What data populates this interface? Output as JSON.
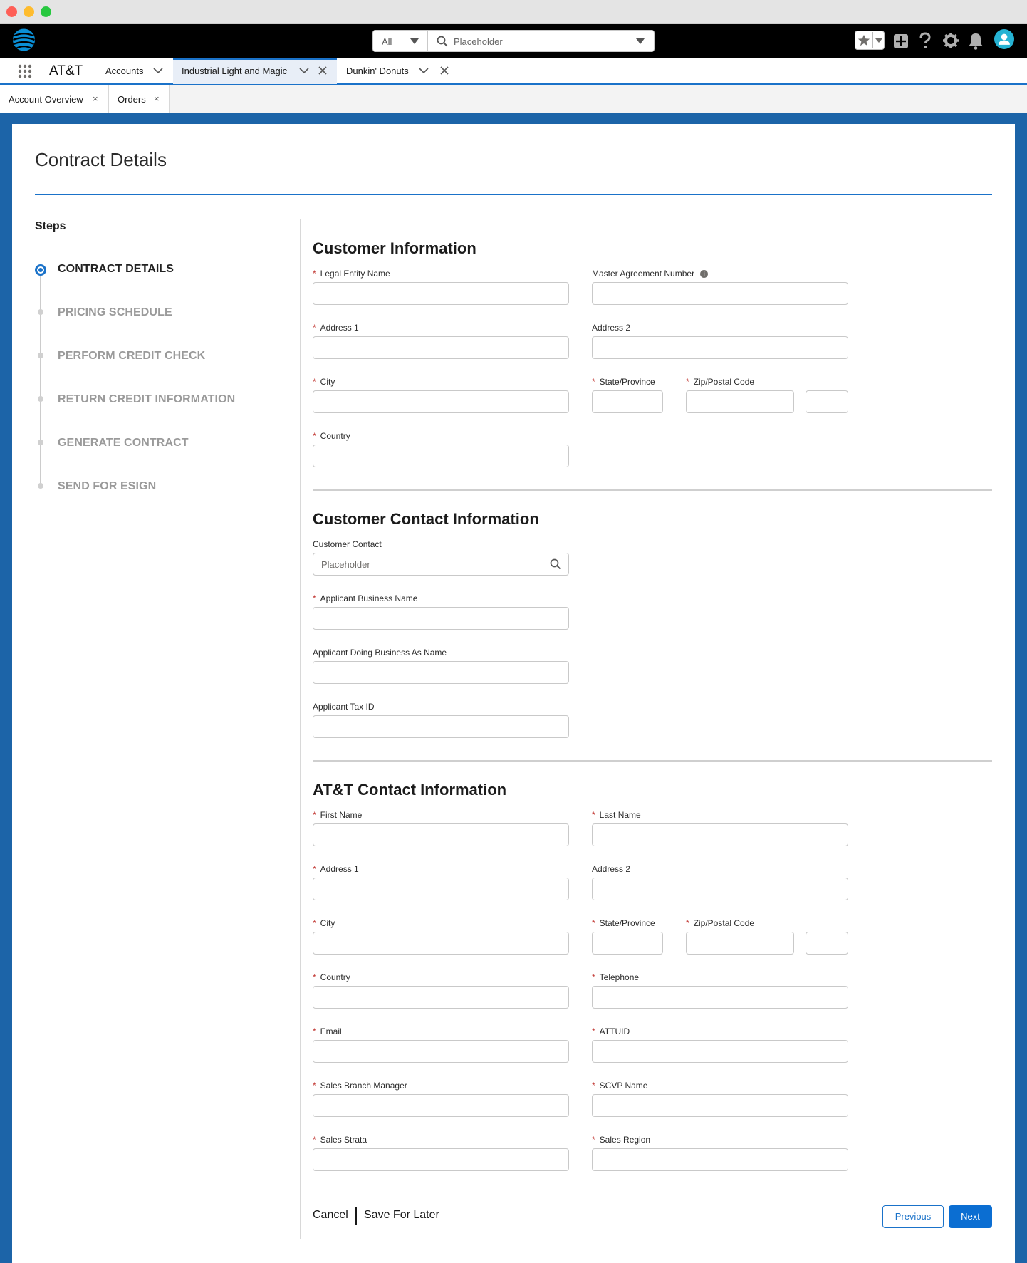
{
  "header": {
    "search_scope": "All",
    "search_placeholder": "Placeholder"
  },
  "appnav": {
    "app_name": "AT&T",
    "tabs": [
      {
        "label": "Accounts"
      },
      {
        "label": "Industrial Light and Magic"
      },
      {
        "label": "Dunkin' Donuts"
      }
    ]
  },
  "subtabs": [
    {
      "label": "Account Overview",
      "close": "×"
    },
    {
      "label": "Orders",
      "close": "×"
    }
  ],
  "page": {
    "title": "Contract Details"
  },
  "steps": {
    "heading": "Steps",
    "items": [
      {
        "label": "CONTRACT DETAILS",
        "current": true
      },
      {
        "label": "PRICING SCHEDULE"
      },
      {
        "label": "PERFORM CREDIT CHECK"
      },
      {
        "label": "RETURN CREDIT INFORMATION"
      },
      {
        "label": "GENERATE CONTRACT"
      },
      {
        "label": "SEND FOR ESIGN"
      }
    ]
  },
  "required_mark": "*",
  "sections": {
    "customer_info": {
      "title": "Customer Information",
      "legal_entity_name": "Legal Entity Name",
      "master_agreement_number": "Master Agreement Number",
      "address1": "Address 1",
      "address2": "Address 2",
      "city": "City",
      "state": "State/Province",
      "zip": "Zip/Postal Code",
      "country": "Country"
    },
    "customer_contact": {
      "title": "Customer Contact Information",
      "customer_contact": "Customer Contact",
      "customer_contact_placeholder": "Placeholder",
      "applicant_business_name": "Applicant Business Name",
      "applicant_dba": "Applicant Doing Business As Name",
      "applicant_tax_id": "Applicant Tax ID"
    },
    "att_contact": {
      "title": "AT&T Contact Information",
      "first_name": "First Name",
      "last_name": "Last Name",
      "address1": "Address 1",
      "address2": "Address 2",
      "city": "City",
      "state": "State/Province",
      "zip": "Zip/Postal Code",
      "country": "Country",
      "telephone": "Telephone",
      "email": "Email",
      "attuid": "ATTUID",
      "sales_branch_manager": "Sales Branch Manager",
      "scvp_name": "SCVP Name",
      "sales_strata": "Sales Strata",
      "sales_region": "Sales Region"
    }
  },
  "footer": {
    "cancel": "Cancel",
    "save_for_later": "Save For Later",
    "previous": "Previous",
    "next": "Next"
  },
  "colors": {
    "brand_blue": "#1a72c9",
    "frame_blue": "#1c64a8",
    "required_red": "#c23934"
  }
}
